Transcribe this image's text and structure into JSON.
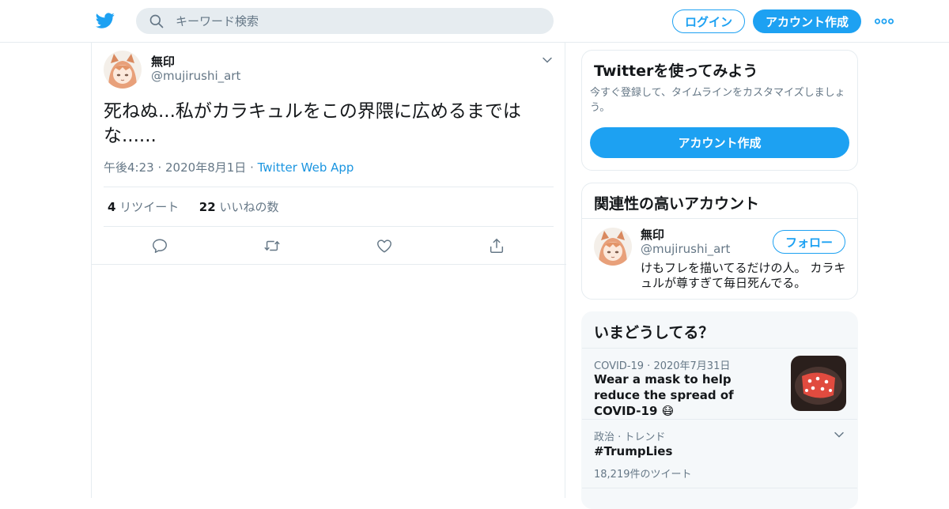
{
  "header": {
    "search_placeholder": "キーワード検索",
    "login_label": "ログイン",
    "signup_label": "アカウント作成"
  },
  "tweet": {
    "name": "無印",
    "handle": "@mujirushi_art",
    "text": "死ねぬ...私がカラキュルをこの界隈に広めるまではな......",
    "time": "午後4:23",
    "date": "2020年8月1日",
    "source": "Twitter Web App",
    "retweet_count": "4",
    "retweet_label": "リツイート",
    "like_count": "22",
    "like_label": "いいねの数"
  },
  "signup_card": {
    "title": "Twitterを使ってみよう",
    "subtitle": "今すぐ登録して、タイムラインをカスタマイズしましょう。",
    "button": "アカウント作成"
  },
  "related": {
    "title": "関連性の高いアカウント",
    "name": "無印",
    "handle": "@mujirushi_art",
    "follow_label": "フォロー",
    "bio": "けもフレを描いてるだけの人。 カラキュルが尊すぎて毎日死んでる。"
  },
  "trends": {
    "title": "いまどうしてる？",
    "items": [
      {
        "meta": "COVID-19 · 2020年7月31日",
        "title": "Wear a mask to help reduce the spread of COVID-19 😷"
      },
      {
        "meta": "政治 · トレンド",
        "title": "#TrumpLies",
        "count": "18,219件のツイート"
      }
    ]
  },
  "colors": {
    "accent": "#1da1f2",
    "muted": "#657786",
    "border": "#e6ecf0"
  }
}
